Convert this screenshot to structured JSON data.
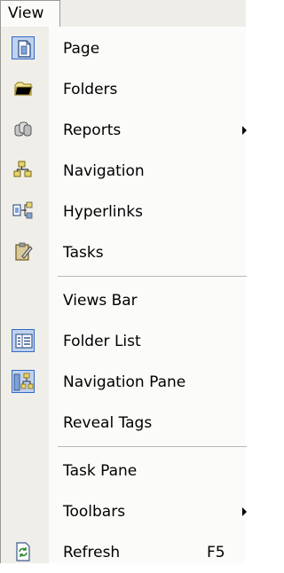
{
  "menu": {
    "title": "View",
    "items": [
      {
        "label": "Page",
        "icon": "page-icon"
      },
      {
        "label": "Folders",
        "icon": "folder-icon"
      },
      {
        "label": "Reports",
        "icon": "reports-icon",
        "submenu": true
      },
      {
        "label": "Navigation",
        "icon": "navigation-icon"
      },
      {
        "label": "Hyperlinks",
        "icon": "hyperlinks-icon"
      },
      {
        "label": "Tasks",
        "icon": "tasks-icon"
      },
      {
        "label": "Views Bar"
      },
      {
        "label": "Folder List",
        "icon": "folder-list-icon"
      },
      {
        "label": "Navigation Pane",
        "icon": "navigation-pane-icon"
      },
      {
        "label": "Reveal Tags"
      },
      {
        "label": "Task Pane"
      },
      {
        "label": "Toolbars",
        "submenu": true
      },
      {
        "label": "Refresh",
        "icon": "refresh-icon",
        "shortcut": "F5"
      }
    ]
  },
  "colors": {
    "gutter": "#efeee9",
    "panel": "#fbfbf9",
    "highlight_border": "#3169c6",
    "highlight_fill": "#c1d2ee"
  }
}
